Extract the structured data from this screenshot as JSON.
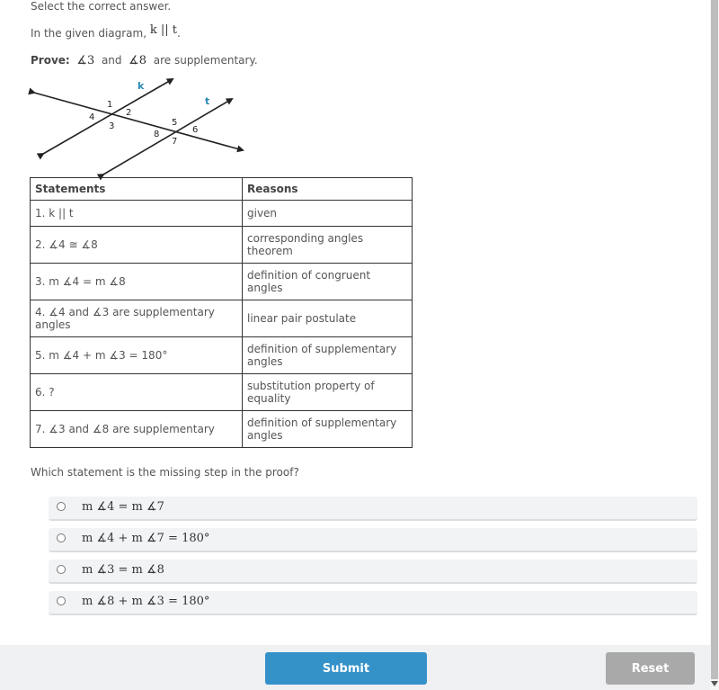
{
  "instruction": "Select the correct answer.",
  "given": {
    "prefix": "In the given diagram,",
    "math": "k || t",
    "suffix": "."
  },
  "prove": {
    "label": "Prove:",
    "angle_a": "∡3",
    "and": "and",
    "angle_b": "∡8",
    "suffix": "are supplementary."
  },
  "diagram": {
    "line_labels": [
      "k",
      "t"
    ],
    "angle_labels": [
      "1",
      "2",
      "3",
      "4",
      "5",
      "6",
      "7",
      "8"
    ],
    "label_color": "#2a8ab5"
  },
  "table": {
    "headers": [
      "Statements",
      "Reasons"
    ],
    "rows": [
      {
        "statement": "1. k || t",
        "reason": "given"
      },
      {
        "statement": "2. ∡4 ≅ ∡8",
        "reason": "corresponding angles theorem"
      },
      {
        "statement": "3. m ∡4 = m ∡8",
        "reason": "definition of congruent angles"
      },
      {
        "statement": "4. ∡4 and ∡3 are supplementary angles",
        "reason": "linear pair postulate"
      },
      {
        "statement": "5. m ∡4 + m ∡3 = 180°",
        "reason": "definition of supplementary angles"
      },
      {
        "statement": "6. ?",
        "reason": "substitution property of equality"
      },
      {
        "statement": "7. ∡3 and ∡8 are supplementary",
        "reason": "definition of supplementary angles"
      }
    ]
  },
  "question": "Which statement is the missing step in the proof?",
  "options": [
    {
      "text": "m ∡4 = m ∡7",
      "selected": false
    },
    {
      "text": "m ∡4 + m ∡7 = 180°",
      "selected": false
    },
    {
      "text": "m ∡3 = m ∡8",
      "selected": false
    },
    {
      "text": "m ∡8 + m ∡3 = 180°",
      "selected": false
    }
  ],
  "buttons": {
    "submit": "Submit",
    "reset": "Reset"
  },
  "colors": {
    "submit": "#3592c9",
    "reset": "#a9a9a9",
    "footer": "#eef0f2"
  }
}
